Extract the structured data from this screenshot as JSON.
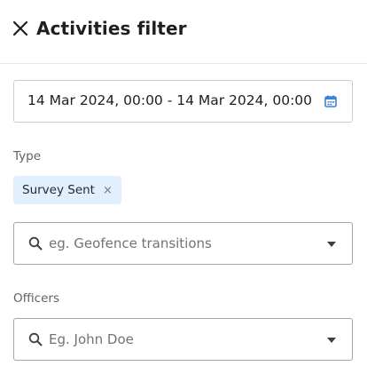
{
  "header": {
    "title": "Activities filter",
    "close_icon": "close-icon"
  },
  "date_range": {
    "value": "14 Mar 2024, 00:00 - 14 Mar 2024, 00:00",
    "icon": "calendar-icon"
  },
  "type_section": {
    "label": "Type",
    "chips": [
      {
        "label": "Survey Sent",
        "remove": "×"
      }
    ],
    "search": {
      "placeholder": "eg. Geofence transitions",
      "value": ""
    }
  },
  "officers_section": {
    "label": "Officers",
    "search": {
      "placeholder": "Eg. John Doe",
      "value": ""
    }
  },
  "colors": {
    "accent": "#3b82d6",
    "chip_bg": "#e1f0fc"
  }
}
